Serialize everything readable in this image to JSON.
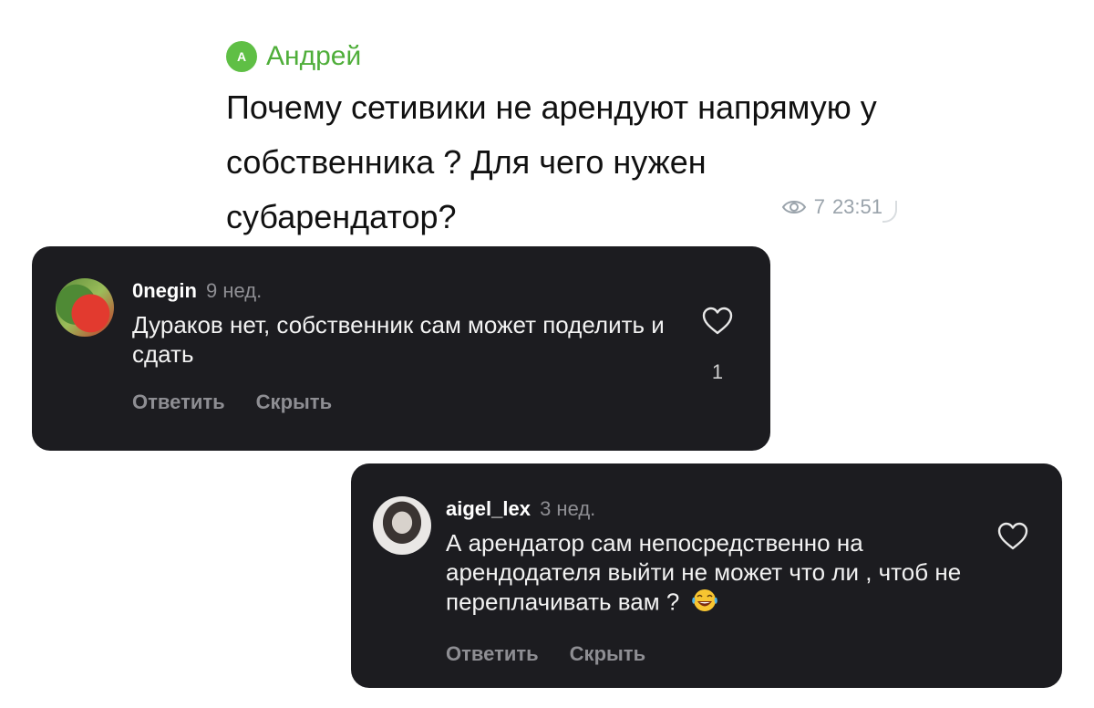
{
  "telegram_post": {
    "avatar_letter": "А",
    "author": "Андрей",
    "text": "Почему сетивики не арендуют напрямую у собственника ? Для чего нужен субарендатор?",
    "views": "7",
    "time": "23:51",
    "icons": {
      "views": "eye-icon"
    }
  },
  "comments": [
    {
      "username": "0negin",
      "age": "9 нед.",
      "text": "Дураков нет, собственник сам может поделить и сдать",
      "likes": "1",
      "reply_label": "Ответить",
      "hide_label": "Скрыть",
      "icons": {
        "like": "heart-icon"
      }
    },
    {
      "username": "aigel_lex",
      "age": "3 нед.",
      "text": "А арендатор сам непосредственно на арендодателя выйти не может что ли , чтоб не переплачивать вам ?",
      "emoji": "face-with-tears-of-joy",
      "reply_label": "Ответить",
      "hide_label": "Скрыть",
      "icons": {
        "like": "heart-icon"
      }
    }
  ],
  "colors": {
    "author_green": "#4fae3a",
    "card_bg": "#1c1c20",
    "muted_text": "#8e8e93"
  }
}
